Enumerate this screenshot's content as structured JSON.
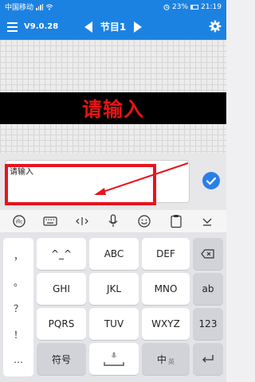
{
  "status_bar": {
    "carrier": "中国移动",
    "battery": "23%",
    "time": "21:19"
  },
  "app_bar": {
    "version": "V9.0.28",
    "program_title": "节目1",
    "icons": [
      "menu-icon",
      "prev-icon",
      "next-icon",
      "gear-icon"
    ]
  },
  "preview": {
    "led_text": "请输入",
    "led_color": "#e41414",
    "led_background": "#000000"
  },
  "input": {
    "value": "请输入",
    "confirm_icon": "check-icon",
    "annotation_color": "#e8141c"
  },
  "keyboard_toolbar": {
    "icons": [
      "ime-logo-icon",
      "keyboard-icon",
      "cursor-move-icon",
      "microphone-icon",
      "emoji-icon",
      "clipboard-icon",
      "hide-keyboard-icon"
    ]
  },
  "keyboard": {
    "punctuation": [
      "，",
      "。",
      "？",
      "！",
      "…"
    ],
    "rows": [
      [
        "^_^",
        "ABC",
        "DEF"
      ],
      [
        "GHI",
        "JKL",
        "MNO"
      ],
      [
        "PQRS",
        "TUV",
        "WXYZ"
      ]
    ],
    "right_keys": [
      "ab",
      "123"
    ],
    "symbols_key": "符号",
    "space_icon": "space-icon",
    "mic_icon": "microphone-icon",
    "lang_key": "中",
    "lang_sub": "英",
    "delete_icon": "backspace-icon",
    "enter_icon": "enter-icon",
    "accent": "#1c82e2"
  }
}
